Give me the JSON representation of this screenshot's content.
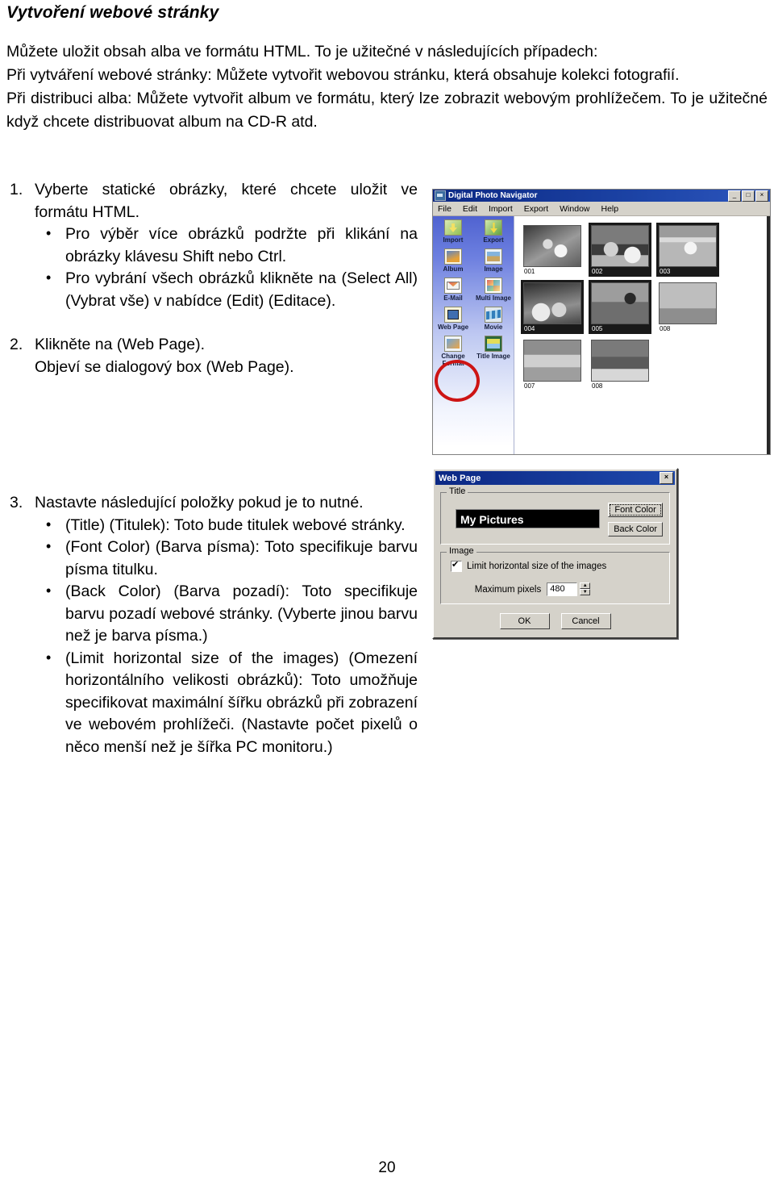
{
  "document": {
    "heading": "Vytvoření webové stránky",
    "page_number": "20",
    "intro_paragraphs": [
      "Můžete uložit obsah alba ve formátu HTML. To je užitečné v následujících případech:",
      "Při vytváření webové stránky: Můžete vytvořit webovou stránku, která obsahuje kolekci fotografií.",
      "Při distribuci alba: Můžete vytvořit album ve formátu, který lze zobrazit webovým prohlížečem. To je užitečné když chcete distribuovat album na CD-R atd."
    ],
    "steps": [
      {
        "number": "1.",
        "text": "Vyberte statické obrázky, které chcete uložit ve formátu HTML.",
        "bullets": [
          "Pro výběr více obrázků podržte při klikání na obrázky klávesu Shift nebo Ctrl.",
          "Pro vybrání všech obrázků klikněte na (Select All) (Vybrat vše) v nabídce (Edit) (Editace)."
        ]
      },
      {
        "number": "2.",
        "text": "Klikněte na (Web Page).",
        "text2": "Objeví se dialogový box (Web Page).",
        "bullets": []
      },
      {
        "number": "3.",
        "text": "Nastavte následující položky pokud je to nutné.",
        "bullets": [
          "(Title) (Titulek): Toto bude titulek webové stránky.",
          "(Font Color) (Barva písma): Toto specifikuje barvu písma titulku.",
          "(Back Color) (Barva pozadí): Toto specifikuje barvu pozadí webové stránky. (Vyberte jinou barvu než je barva písma.)",
          "(Limit horizontal size of the images) (Omezení horizontálního velikosti obrázků): Toto umožňuje specifikovat maximální šířku obrázků při zobrazení ve webovém prohlížeči. (Nastavte počet pixelů o něco menší než je šířka PC monitoru.)"
        ]
      }
    ]
  },
  "navigator_window": {
    "title": "Digital Photo Navigator",
    "menu": [
      "File",
      "Edit",
      "Import",
      "Export",
      "Window",
      "Help"
    ],
    "title_buttons": {
      "minimize": "_",
      "maximize": "□",
      "close": "×"
    },
    "sidebar_rows": [
      [
        {
          "label": "Import",
          "icon": "import-icon"
        },
        {
          "label": "Export",
          "icon": "export-icon"
        }
      ],
      [
        {
          "label": "Album",
          "icon": "album-icon"
        },
        {
          "label": "Image",
          "icon": "image-icon"
        }
      ],
      [
        {
          "label": "E-Mail",
          "icon": "email-icon"
        },
        {
          "label": "Multi Image",
          "icon": "multi-image-icon"
        }
      ],
      [
        {
          "label": "Web Page",
          "icon": "web-page-icon"
        },
        {
          "label": "Movie",
          "icon": "movie-icon"
        }
      ],
      [
        {
          "label": "Change Format",
          "icon": "change-format-icon"
        },
        {
          "label": "Title Image",
          "icon": "title-image-icon"
        }
      ]
    ],
    "highlight": {
      "target": "Web Page",
      "color": "#d81313"
    },
    "thumbnail_rows": [
      [
        {
          "caption": "001",
          "selected": false
        },
        {
          "caption": "002",
          "selected": true
        },
        {
          "caption": "003",
          "selected": true
        }
      ],
      [
        {
          "caption": "004",
          "selected": true
        },
        {
          "caption": "005",
          "selected": true
        },
        {
          "caption": "008",
          "selected": false
        }
      ],
      [
        {
          "caption": "007",
          "selected": false
        },
        {
          "caption": "008",
          "selected": false
        }
      ]
    ]
  },
  "web_page_dialog": {
    "title": "Web Page",
    "close_label": "×",
    "title_group": {
      "legend": "Title",
      "value": "My Pictures",
      "font_color_button": "Font Color",
      "back_color_button": "Back Color"
    },
    "image_group": {
      "legend": "Image",
      "checkbox_label": "Limit horizontal size of the images",
      "checkbox_checked": true,
      "max_pixels_label": "Maximum pixels",
      "max_pixels_value": "480",
      "spin_up": "▲",
      "spin_down": "▼"
    },
    "ok_button": "OK",
    "cancel_button": "Cancel"
  }
}
